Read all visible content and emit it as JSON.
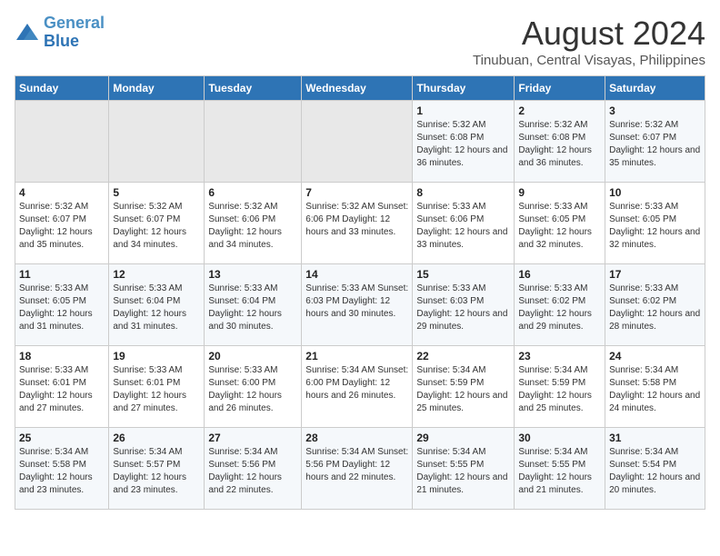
{
  "header": {
    "logo_line1": "General",
    "logo_line2": "Blue",
    "title": "August 2024",
    "subtitle": "Tinubuan, Central Visayas, Philippines"
  },
  "columns": [
    "Sunday",
    "Monday",
    "Tuesday",
    "Wednesday",
    "Thursday",
    "Friday",
    "Saturday"
  ],
  "weeks": [
    {
      "days": [
        {
          "num": "",
          "detail": "",
          "empty": true
        },
        {
          "num": "",
          "detail": "",
          "empty": true
        },
        {
          "num": "",
          "detail": "",
          "empty": true
        },
        {
          "num": "",
          "detail": "",
          "empty": true
        },
        {
          "num": "1",
          "detail": "Sunrise: 5:32 AM\nSunset: 6:08 PM\nDaylight: 12 hours\nand 36 minutes."
        },
        {
          "num": "2",
          "detail": "Sunrise: 5:32 AM\nSunset: 6:08 PM\nDaylight: 12 hours\nand 36 minutes."
        },
        {
          "num": "3",
          "detail": "Sunrise: 5:32 AM\nSunset: 6:07 PM\nDaylight: 12 hours\nand 35 minutes."
        }
      ]
    },
    {
      "days": [
        {
          "num": "4",
          "detail": "Sunrise: 5:32 AM\nSunset: 6:07 PM\nDaylight: 12 hours\nand 35 minutes."
        },
        {
          "num": "5",
          "detail": "Sunrise: 5:32 AM\nSunset: 6:07 PM\nDaylight: 12 hours\nand 34 minutes."
        },
        {
          "num": "6",
          "detail": "Sunrise: 5:32 AM\nSunset: 6:06 PM\nDaylight: 12 hours\nand 34 minutes."
        },
        {
          "num": "7",
          "detail": "Sunrise: 5:32 AM\nSunset: 6:06 PM\nDaylight: 12 hours\nand 33 minutes."
        },
        {
          "num": "8",
          "detail": "Sunrise: 5:33 AM\nSunset: 6:06 PM\nDaylight: 12 hours\nand 33 minutes."
        },
        {
          "num": "9",
          "detail": "Sunrise: 5:33 AM\nSunset: 6:05 PM\nDaylight: 12 hours\nand 32 minutes."
        },
        {
          "num": "10",
          "detail": "Sunrise: 5:33 AM\nSunset: 6:05 PM\nDaylight: 12 hours\nand 32 minutes."
        }
      ]
    },
    {
      "days": [
        {
          "num": "11",
          "detail": "Sunrise: 5:33 AM\nSunset: 6:05 PM\nDaylight: 12 hours\nand 31 minutes."
        },
        {
          "num": "12",
          "detail": "Sunrise: 5:33 AM\nSunset: 6:04 PM\nDaylight: 12 hours\nand 31 minutes."
        },
        {
          "num": "13",
          "detail": "Sunrise: 5:33 AM\nSunset: 6:04 PM\nDaylight: 12 hours\nand 30 minutes."
        },
        {
          "num": "14",
          "detail": "Sunrise: 5:33 AM\nSunset: 6:03 PM\nDaylight: 12 hours\nand 30 minutes."
        },
        {
          "num": "15",
          "detail": "Sunrise: 5:33 AM\nSunset: 6:03 PM\nDaylight: 12 hours\nand 29 minutes."
        },
        {
          "num": "16",
          "detail": "Sunrise: 5:33 AM\nSunset: 6:02 PM\nDaylight: 12 hours\nand 29 minutes."
        },
        {
          "num": "17",
          "detail": "Sunrise: 5:33 AM\nSunset: 6:02 PM\nDaylight: 12 hours\nand 28 minutes."
        }
      ]
    },
    {
      "days": [
        {
          "num": "18",
          "detail": "Sunrise: 5:33 AM\nSunset: 6:01 PM\nDaylight: 12 hours\nand 27 minutes."
        },
        {
          "num": "19",
          "detail": "Sunrise: 5:33 AM\nSunset: 6:01 PM\nDaylight: 12 hours\nand 27 minutes."
        },
        {
          "num": "20",
          "detail": "Sunrise: 5:33 AM\nSunset: 6:00 PM\nDaylight: 12 hours\nand 26 minutes."
        },
        {
          "num": "21",
          "detail": "Sunrise: 5:34 AM\nSunset: 6:00 PM\nDaylight: 12 hours\nand 26 minutes."
        },
        {
          "num": "22",
          "detail": "Sunrise: 5:34 AM\nSunset: 5:59 PM\nDaylight: 12 hours\nand 25 minutes."
        },
        {
          "num": "23",
          "detail": "Sunrise: 5:34 AM\nSunset: 5:59 PM\nDaylight: 12 hours\nand 25 minutes."
        },
        {
          "num": "24",
          "detail": "Sunrise: 5:34 AM\nSunset: 5:58 PM\nDaylight: 12 hours\nand 24 minutes."
        }
      ]
    },
    {
      "days": [
        {
          "num": "25",
          "detail": "Sunrise: 5:34 AM\nSunset: 5:58 PM\nDaylight: 12 hours\nand 23 minutes."
        },
        {
          "num": "26",
          "detail": "Sunrise: 5:34 AM\nSunset: 5:57 PM\nDaylight: 12 hours\nand 23 minutes."
        },
        {
          "num": "27",
          "detail": "Sunrise: 5:34 AM\nSunset: 5:56 PM\nDaylight: 12 hours\nand 22 minutes."
        },
        {
          "num": "28",
          "detail": "Sunrise: 5:34 AM\nSunset: 5:56 PM\nDaylight: 12 hours\nand 22 minutes."
        },
        {
          "num": "29",
          "detail": "Sunrise: 5:34 AM\nSunset: 5:55 PM\nDaylight: 12 hours\nand 21 minutes."
        },
        {
          "num": "30",
          "detail": "Sunrise: 5:34 AM\nSunset: 5:55 PM\nDaylight: 12 hours\nand 21 minutes."
        },
        {
          "num": "31",
          "detail": "Sunrise: 5:34 AM\nSunset: 5:54 PM\nDaylight: 12 hours\nand 20 minutes."
        }
      ]
    }
  ]
}
